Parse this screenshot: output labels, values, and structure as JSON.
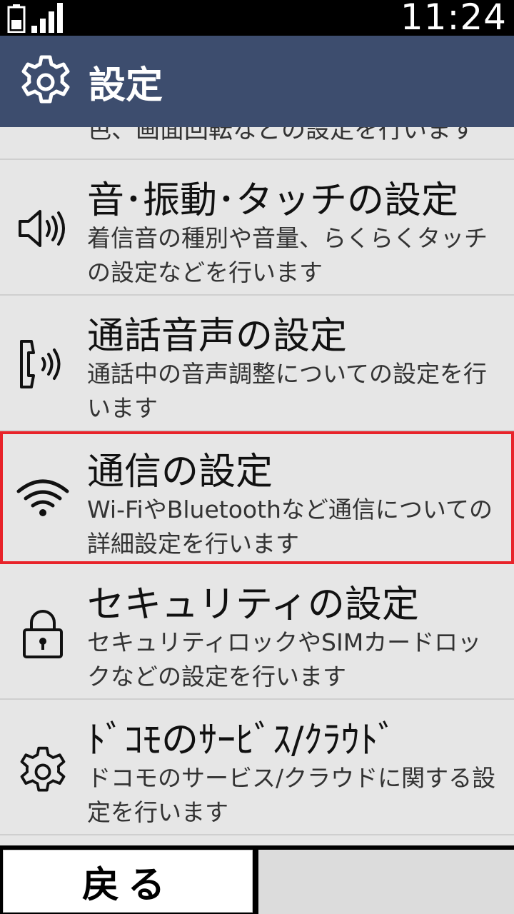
{
  "status_bar": {
    "time": "11:24",
    "battery_icon": "battery-icon",
    "signal_icon": "signal-icon"
  },
  "header": {
    "title": "設定",
    "icon": "gear-icon"
  },
  "clipped_item": {
    "desc": "色、画面回転などの設定を行います"
  },
  "items": [
    {
      "title": "音･振動･タッチの設定",
      "desc": "着信音の種別や音量、らくらくタッチの設定などを行います",
      "icon": "speaker-icon"
    },
    {
      "title": "通話音声の設定",
      "desc": "通話中の音声調整についての設定を行います",
      "icon": "phone-sound-icon"
    },
    {
      "title": "通信の設定",
      "desc": "Wi-FiやBluetoothなど通信についての詳細設定を行います",
      "icon": "wifi-icon"
    },
    {
      "title": "セキュリティの設定",
      "desc": "セキュリティロックやSIMカードロックなどの設定を行います",
      "icon": "lock-icon"
    },
    {
      "title": "ﾄﾞｺﾓのｻｰﾋﾞｽ/ｸﾗｳﾄﾞ",
      "desc": "ドコモのサービス/クラウドに関する設定を行います",
      "icon": "gear-icon"
    }
  ],
  "bottom_bar": {
    "back_label": "戻る"
  },
  "colors": {
    "header_bg": "#3d4d6e",
    "selected_outline": "#e8232a",
    "list_bg": "#e6e6e6"
  }
}
